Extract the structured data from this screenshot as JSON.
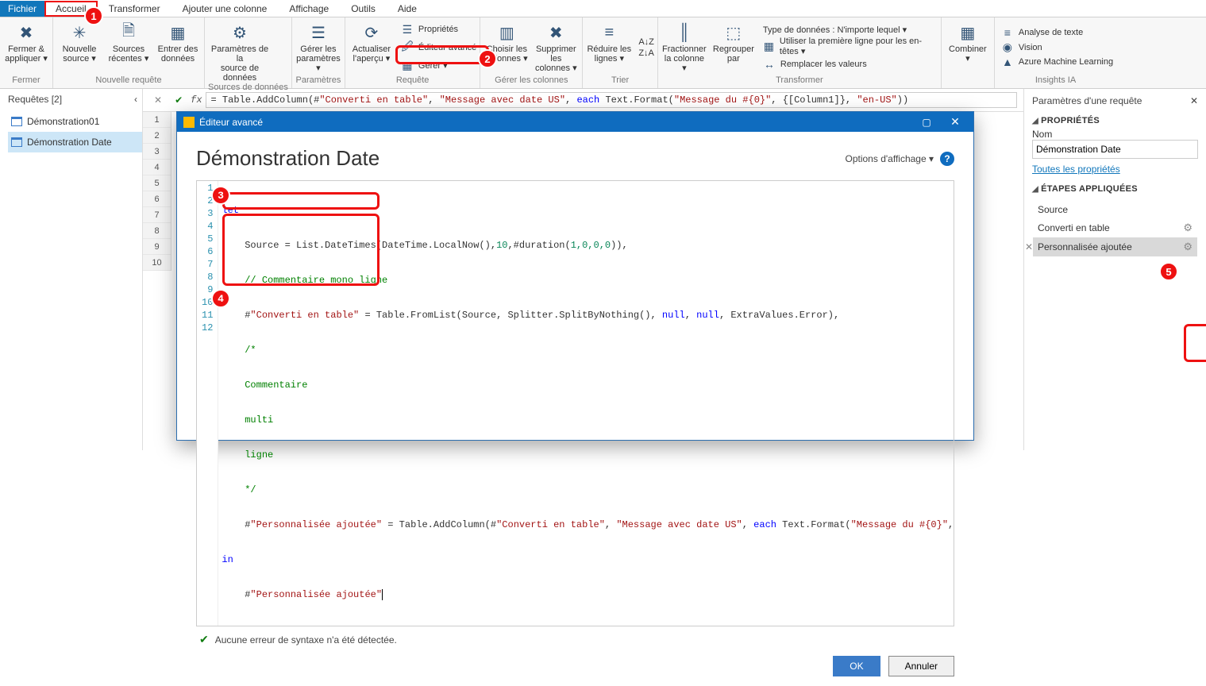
{
  "tabs": {
    "file": "Fichier",
    "home": "Accueil",
    "transform": "Transformer",
    "addcol": "Ajouter une colonne",
    "view": "Affichage",
    "tools": "Outils",
    "help": "Aide"
  },
  "ribbon": {
    "close": {
      "l1": "Fermer &",
      "l2": "appliquer ▾",
      "group": "Fermer"
    },
    "newq": {
      "nsrc1": "Nouvelle",
      "nsrc2": "source ▾",
      "rec1": "Sources",
      "rec2": "récentes ▾",
      "ent1": "Entrer des",
      "ent2": "données",
      "group": "Nouvelle requête"
    },
    "dsparams": {
      "l1": "Paramètres de la",
      "l2": "source de données",
      "group": "Sources de données"
    },
    "params": {
      "l1": "Gérer les",
      "l2": "paramètres ▾",
      "group": "Paramètres"
    },
    "query": {
      "refresh1": "Actualiser",
      "refresh2": "l'aperçu ▾",
      "props": "Propriétés",
      "adveditor": "Éditeur avancé",
      "manage": "Gérer ▾",
      "group": "Requête"
    },
    "cols": {
      "choose1": "Choisir les",
      "choose2": "colonnes ▾",
      "remove1": "Supprimer les",
      "remove2": "colonnes ▾",
      "group": "Gérer les colonnes"
    },
    "rows": {
      "reduce1": "Réduire les",
      "reduce2": "lignes ▾",
      "group": "Trier"
    },
    "sort": {
      "up": "A↓Z",
      "down": "Z↓A"
    },
    "split": {
      "frac1": "Fractionner",
      "frac2": "la colonne ▾",
      "grp1": "Regrouper",
      "grp2": "par"
    },
    "transform": {
      "dtype": "Type de données : N'importe lequel ▾",
      "firstrow": "Utiliser la première ligne pour les en-têtes ▾",
      "replace": "Remplacer les valeurs",
      "group": "Transformer"
    },
    "combine": {
      "l1": "Combiner",
      "l2": "▾"
    },
    "ia": {
      "text": "Analyse de texte",
      "vision": "Vision",
      "aml": "Azure Machine Learning",
      "group": "Insights IA"
    }
  },
  "queries": {
    "title": "Requêtes [2]",
    "items": [
      "Démonstration01",
      "Démonstration Date"
    ]
  },
  "fxbar": {
    "prefix": "= Table.AddColumn(#",
    "s1": "\"Converti en table\"",
    "c1": ", ",
    "s2": "\"Message avec date US\"",
    "c2": ", ",
    "kw": "each",
    "rest": " Text.Format(",
    "s3": "\"Message du #{0}\"",
    "c3": ", {[Column1]}, ",
    "s4": "\"en-US\"",
    "end": "))"
  },
  "grid_rows": [
    "1",
    "2",
    "3",
    "4",
    "5",
    "6",
    "7",
    "8",
    "9",
    "10"
  ],
  "modal": {
    "title": "Éditeur avancé",
    "heading": "Démonstration Date",
    "display_options": "Options d'affichage ▾",
    "status": "Aucune erreur de syntaxe n'a été détectée.",
    "ok": "OK",
    "cancel": "Annuler",
    "lines": [
      "1",
      "2",
      "3",
      "4",
      "5",
      "6",
      "7",
      "8",
      "9",
      "10",
      "11",
      "12"
    ],
    "code": {
      "l1_kw": "let",
      "l2a": "    Source = List.DateTimes(DateTime.LocalNow(),",
      "l2n": "10",
      "l2b": ",#duration(",
      "l2c": "1,0,0,0",
      "l2d": ")),",
      "l3": "    // Commentaire mono ligne",
      "l4a": "    #",
      "l4s": "\"Converti en table\"",
      "l4b": " = Table.FromList(Source, Splitter.SplitByNothing(), ",
      "l4kw1": "null",
      "l4c": ", ",
      "l4kw2": "null",
      "l4d": ", ExtraValues.Error),",
      "l5": "    /*",
      "l6": "    Commentaire",
      "l7": "    multi",
      "l8": "    ligne",
      "l9": "    */",
      "l10a": "    #",
      "l10s1": "\"Personnalisée ajoutée\"",
      "l10b": " = Table.AddColumn(#",
      "l10s2": "\"Converti en table\"",
      "l10c": ", ",
      "l10s3": "\"Message avec date US\"",
      "l10d": ", ",
      "l10kw": "each",
      "l10e": " Text.Format(",
      "l10s4": "\"Message du #{0}\"",
      "l10f": ", {[Colum",
      "l11_kw": "in",
      "l12a": "    #",
      "l12s": "\"Personnalisée ajoutée\""
    }
  },
  "params_pane": {
    "title": "Paramètres d'une requête",
    "properties": "PROPRIÉTÉS",
    "name_label": "Nom",
    "name_value": "Démonstration Date",
    "all_props": "Toutes les propriétés",
    "steps_title": "ÉTAPES APPLIQUÉES",
    "steps": [
      "Source",
      "Converti en table",
      "Personnalisée ajoutée"
    ]
  },
  "badges": {
    "b1": "1",
    "b2": "2",
    "b3": "3",
    "b4": "4",
    "b5": "5"
  }
}
